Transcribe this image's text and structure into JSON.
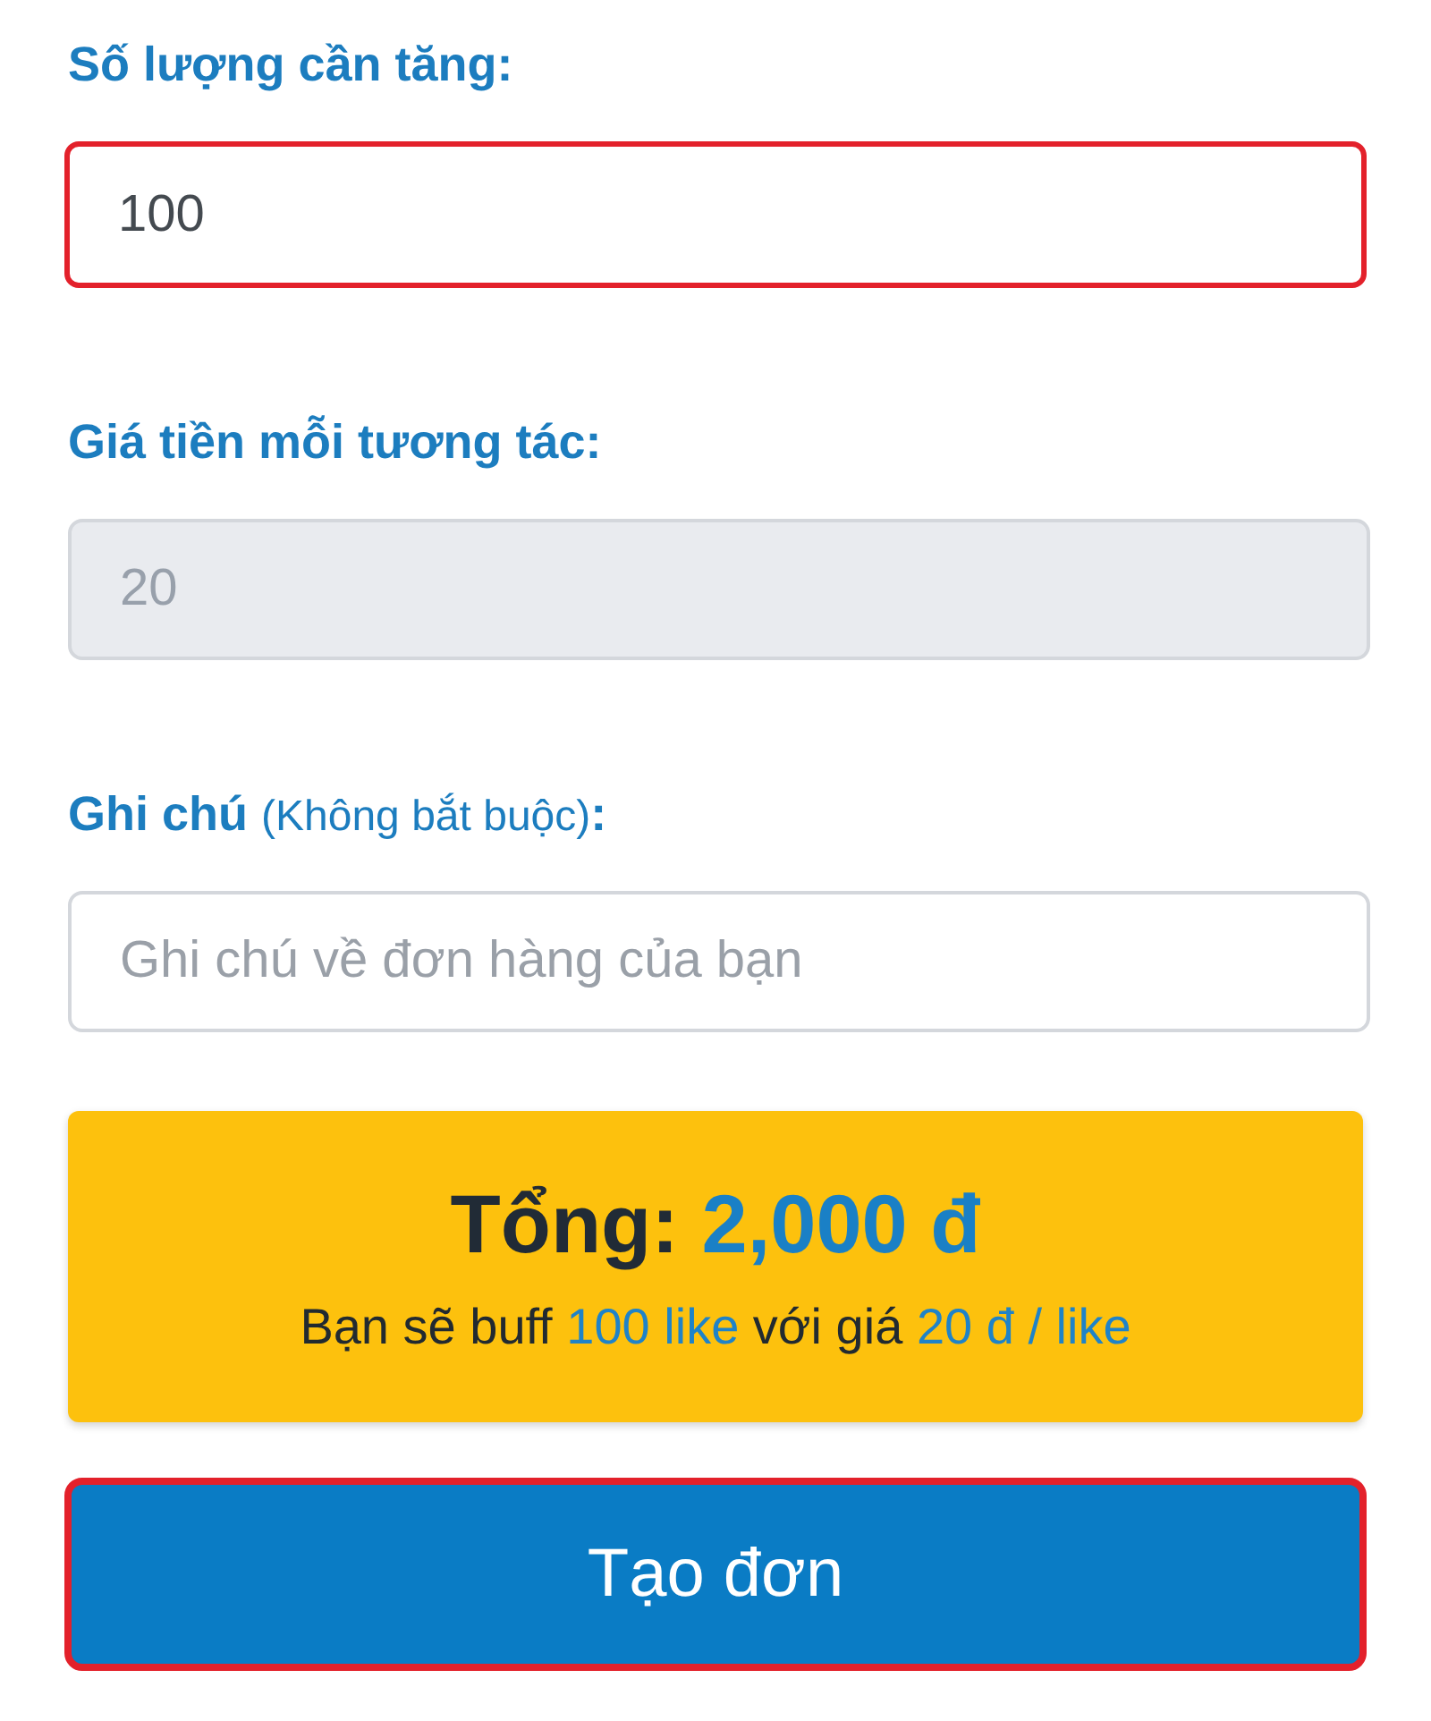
{
  "fields": [
    {
      "label": "Số lượng cần tăng:",
      "value": "100",
      "highlighted": true,
      "disabled": false
    },
    {
      "label": "Giá tiền mỗi tương tác:",
      "value": "20",
      "highlighted": false,
      "disabled": true
    },
    {
      "label": "Ghi chú",
      "note": "(Không bắt buộc)",
      "label_suffix": ":",
      "placeholder": "Ghi chú về đơn hàng của bạn",
      "highlighted": false,
      "disabled": false
    }
  ],
  "total": {
    "label": "Tổng:",
    "amount": "2,000 đ",
    "summary": [
      {
        "kind": "text",
        "text": "Bạn sẽ buff"
      },
      {
        "kind": "value",
        "text": "100 like"
      },
      {
        "kind": "text",
        "text": "với giá"
      },
      {
        "kind": "value",
        "text": "20 đ / like"
      }
    ]
  },
  "button": {
    "label": "Tạo đơn",
    "highlighted": true
  }
}
